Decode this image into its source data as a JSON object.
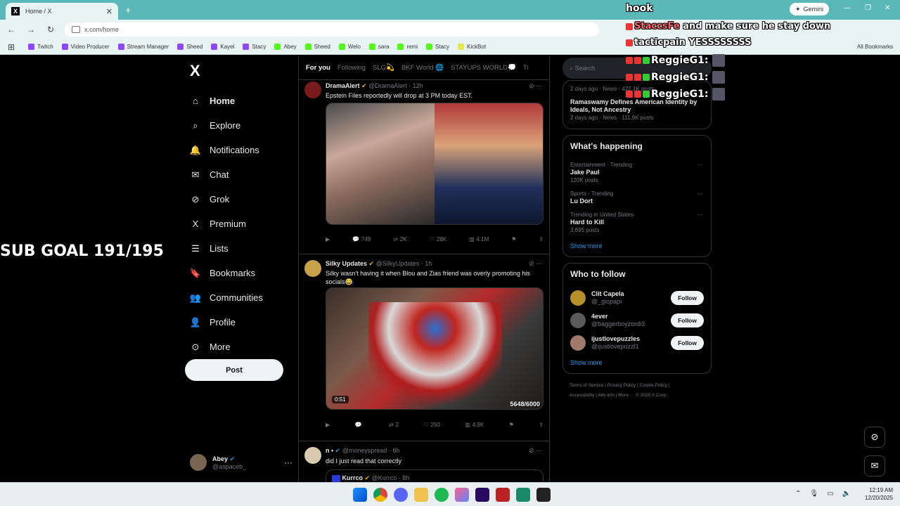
{
  "browser": {
    "tab_title": "Home / X",
    "tab_close": "✕",
    "new_tab": "+",
    "url": "x.com/home",
    "gemini_label": "Gemini",
    "bookmarks": [
      "Twitch",
      "Video Producer",
      "Stream Manager",
      "Sheed",
      "Kayel",
      "Stacy",
      "Abey",
      "Sheed",
      "Welo",
      "sara",
      "remi",
      "Stacy",
      "KickBot"
    ],
    "all_bookmarks": "All Bookmarks"
  },
  "nav": {
    "logo": "X",
    "items": [
      "Home",
      "Explore",
      "Notifications",
      "Chat",
      "Grok",
      "Premium",
      "Lists",
      "Bookmarks",
      "Communities",
      "Profile",
      "More"
    ],
    "post_label": "Post",
    "profile_name": "Abey",
    "profile_handle": "@aspaceb_"
  },
  "feed": {
    "tabs": [
      "For you",
      "Following",
      "SLG💫",
      "BKF World 🌐",
      "STAYUPS WORLD💭",
      "Ti"
    ],
    "tweets": [
      {
        "name": "DramaAlert",
        "handle": "@DramaAlert · 12h",
        "text": "Epstein Files reportedly will drop at 3 PM today EST.",
        "replies": "749",
        "retweets": "2K",
        "likes": "28K",
        "views": "4.1M"
      },
      {
        "name": "Silky Updates",
        "handle": "@SilkyUpdates · 1h",
        "text": "Silky wasn't having it when Blou and Zias friend was overly promoting his socials😂",
        "video_time": "0:51",
        "video_overlay": "5648/6000",
        "replies": "",
        "retweets": "2",
        "likes": "250",
        "views": "4.9K"
      },
      {
        "name": "n •",
        "handle": "@moneyspread · 8h",
        "text": "did I just read that correctly",
        "quote_name": "Kurrco",
        "quote_handle": "@Kurrco · 8h"
      }
    ]
  },
  "right": {
    "search_placeholder": "Search",
    "top_meta1": "2 days ago · News · 422.1K posts",
    "top_headline": "Ramaswamy Defines American Identity by Ideals, Not Ancestry",
    "top_meta2": "2 days ago · News · 111.9K posts",
    "happening_title": "What's happening",
    "trends": [
      {
        "context": "Entertainment · Trending",
        "name": "Jake Paul",
        "count": "120K posts"
      },
      {
        "context": "Sports · Trending",
        "name": "Lu Dort",
        "count": ""
      },
      {
        "context": "Trending in United States",
        "name": "Hard to Kill",
        "count": "3,695 posts"
      }
    ],
    "show_more": "Show more",
    "wtf_title": "Who to follow",
    "follow_label": "Follow",
    "who_to_follow": [
      {
        "name": "Clit Capela",
        "handle": "@_glopapi"
      },
      {
        "name": "4ever",
        "handle": "@baggerboyzordi3"
      },
      {
        "name": "ijustlovepuzzles",
        "handle": "@ijustlovepuzzl1"
      }
    ],
    "footer1": "Terms of Service  |  Privacy Policy  |  Cookie Policy  |",
    "footer2": "Accessibility  |  Ads info  |  More ···  © 2025 X Corp."
  },
  "stream_overlay": {
    "sub_goal": "SUB GOAL 191/195",
    "hook": "hook",
    "chat": [
      {
        "user": "StaccsFe",
        "msg": "and make sure he stay down"
      },
      {
        "user": "tacticpain",
        "msg": "YESSSSSSSS"
      },
      {
        "user": "ReggieG1:",
        "msg": ""
      },
      {
        "user": "ReggieG1:",
        "msg": ""
      },
      {
        "user": "ReggieG1:",
        "msg": ""
      }
    ]
  },
  "taskbar": {
    "time": "12:19 AM",
    "date": "12/20/2025"
  },
  "colors": {
    "chrome_accent": "#5ab8b8",
    "link_blue": "#1d9bf0",
    "bg": "#000000"
  }
}
